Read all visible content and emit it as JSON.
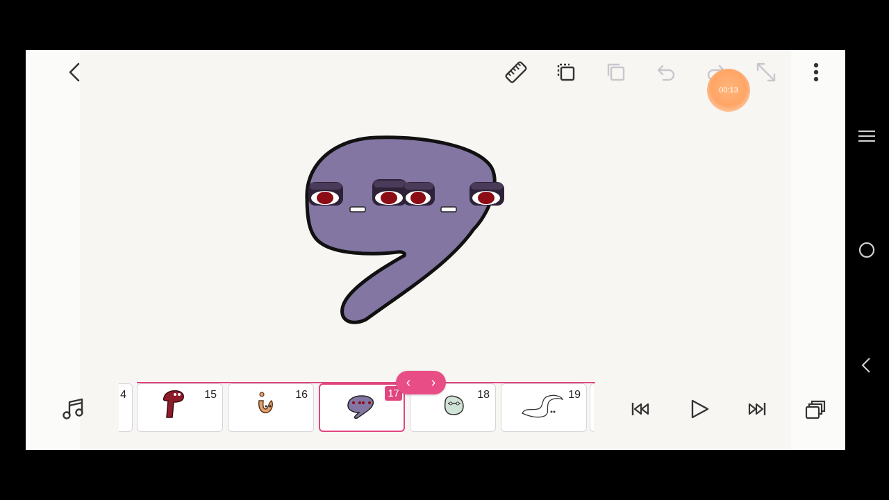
{
  "toolbar": {
    "timer": "00:13"
  },
  "filmstrip": {
    "frames": [
      {
        "num": "4"
      },
      {
        "num": "15"
      },
      {
        "num": "16"
      },
      {
        "num": "17"
      },
      {
        "num": "18"
      },
      {
        "num": "19"
      }
    ],
    "active_frame": "17"
  },
  "nav_pill": {
    "prev": "‹",
    "next": "›"
  },
  "colors": {
    "accent": "#e0457e",
    "character_fill": "#8376a2",
    "timer": "#ffa566"
  },
  "icons": [
    "back-icon",
    "ruler-icon",
    "copy-icon",
    "paste-icon",
    "undo-icon",
    "redo-icon",
    "expand-icon",
    "more-icon",
    "music-icon",
    "skip-first-icon",
    "play-icon",
    "skip-last-icon",
    "layers-icon",
    "menu-icon",
    "home-icon",
    "system-back-icon"
  ]
}
